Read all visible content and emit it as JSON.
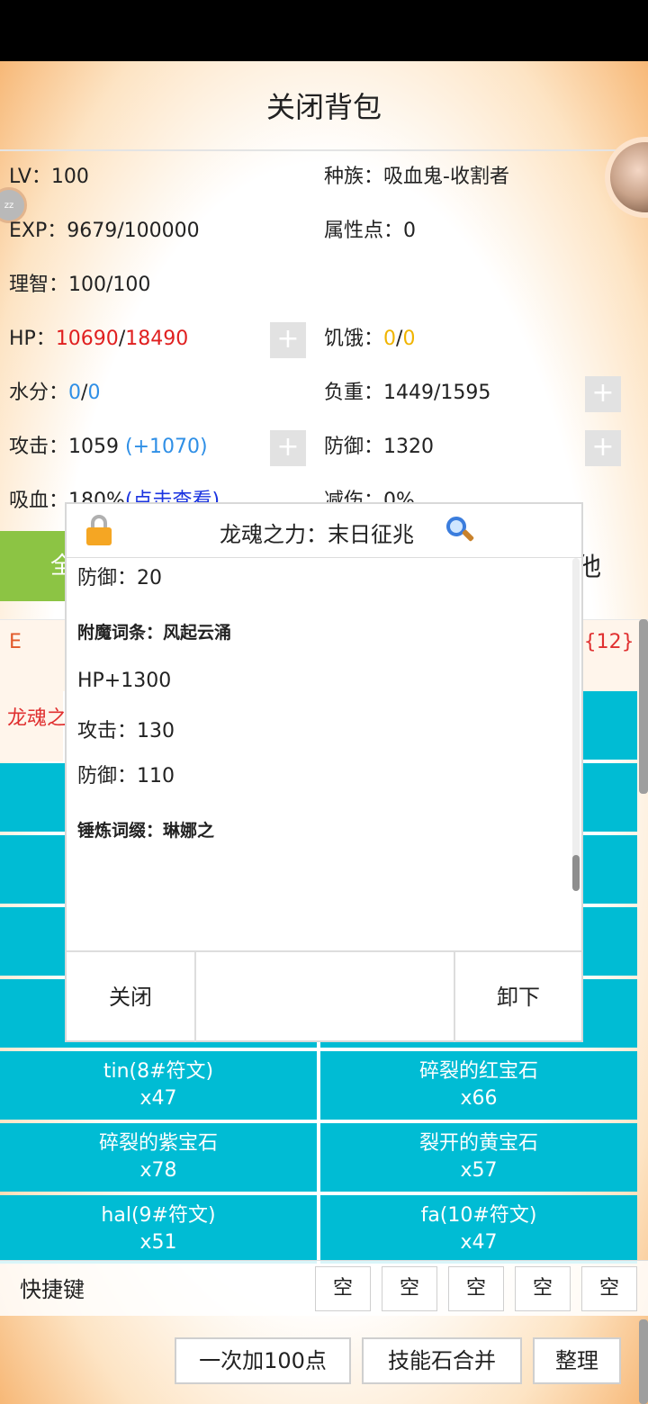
{
  "header": {
    "title": "关闭背包"
  },
  "stats": {
    "lv_label": "LV：",
    "lv": "100",
    "race_label": "种族：",
    "race": "吸血鬼-收割者",
    "exp_label": "EXP：",
    "exp": "9679/100000",
    "attr_label": "属性点：",
    "attr": "0",
    "sanity_label": "理智：",
    "sanity": "100/100",
    "hp_label": "HP：",
    "hp_cur": "10690",
    "hp_sep": "/",
    "hp_max": "18490",
    "hunger_label": "饥饿：",
    "hunger_cur": "0",
    "hunger_sep": "/",
    "hunger_max": "0",
    "water_label": "水分：",
    "water_cur": "0",
    "water_sep": "/",
    "water_max": "0",
    "load_label": "负重：",
    "load": "1449/1595",
    "atk_label": "攻击：",
    "atk": "1059",
    "atk_bonus": "(+1070)",
    "def_label": "防御：",
    "def": "1320",
    "vamp_label": "吸血：",
    "vamp": "180%",
    "vamp_link": "(点击查看)",
    "reduce_label": "减伤：",
    "reduce": "0%",
    "plus": "+"
  },
  "tabs": {
    "left_partial": "全",
    "right_partial": "他"
  },
  "equipped_row": {
    "left": "E",
    "right": "){12}"
  },
  "dragon_row": {
    "text": "龙魂之"
  },
  "inventory": [
    {
      "name": "tin(8#符文)",
      "count": "x47"
    },
    {
      "name": "碎裂的红宝石",
      "count": "x66"
    },
    {
      "name": "碎裂的紫宝石",
      "count": "x78"
    },
    {
      "name": "裂开的黄宝石",
      "count": "x57"
    },
    {
      "name": "hal(9#符文)",
      "count": "x51"
    },
    {
      "name": "fa(10#符文)",
      "count": "x47"
    }
  ],
  "quickbar": {
    "label": "快捷键",
    "slots": [
      "空",
      "空",
      "空",
      "空",
      "空"
    ]
  },
  "buttons": {
    "add100": "一次加100点",
    "merge": "技能石合并",
    "sort": "整理"
  },
  "dialog": {
    "title": "龙魂之力：末日征兆",
    "lines": [
      "防御：20",
      "附魔词条：风起云涌",
      "HP+1300",
      "攻击：130",
      "防御：110",
      "锤炼词缀：琳娜之"
    ],
    "close": "关闭",
    "unequip": "卸下"
  },
  "colors": {
    "accent_cyan": "#00bcd4",
    "tab_green": "#8cc444",
    "hp_red": "#e02020",
    "hunger_yellow": "#f0b400",
    "water_blue": "#2f8fe6"
  }
}
